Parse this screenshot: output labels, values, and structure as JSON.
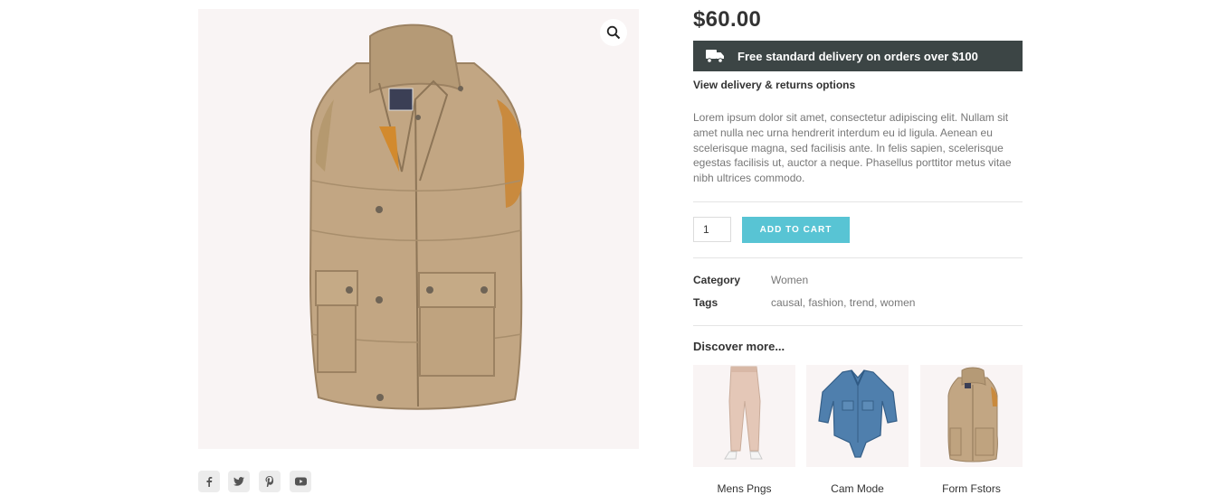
{
  "product": {
    "price": "$60.00",
    "delivery_banner": "Free standard delivery on orders over $100",
    "delivery_link": "View delivery & returns options",
    "description": "Lorem ipsum dolor sit amet, consectetur adipiscing elit. Nullam sit amet nulla nec urna hendrerit interdum eu id ligula. Aenean eu scelerisque magna, sed facilisis ante. In felis sapien, scelerisque egestas facilisis ut, auctor a neque. Phasellus porttitor metus vitae nibh ultrices commodo.",
    "quantity": "1",
    "add_to_cart": "ADD TO CART",
    "category_label": "Category",
    "category_value": "Women",
    "tags_label": "Tags",
    "tags": [
      "causal",
      "fashion",
      "trend",
      "women"
    ],
    "tag_separator": ", "
  },
  "gallery": {
    "zoom_icon": "magnifier-icon",
    "main_image": "tan-puffer-vest-image"
  },
  "social": {
    "icons": [
      "facebook-icon",
      "twitter-icon",
      "pinterest-icon",
      "youtube-icon"
    ]
  },
  "discover": {
    "title": "Discover more...",
    "items": [
      {
        "name": "Mens Pngs",
        "image": "beige-pants-image"
      },
      {
        "name": "Cam Mode",
        "image": "denim-shirt-image"
      },
      {
        "name": "Form Fstors",
        "image": "tan-vest-image"
      }
    ]
  },
  "colors": {
    "banner_bg": "#3c4545",
    "accent": "#58c4d4",
    "image_bg": "#f9f4f4"
  }
}
